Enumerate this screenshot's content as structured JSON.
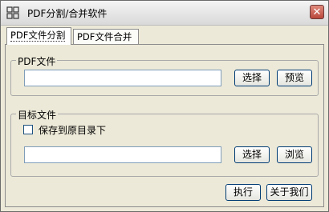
{
  "window": {
    "title": "PDF分割/合并软件",
    "close_glyph": "✕"
  },
  "tabs": [
    {
      "label": "PDF文件分割",
      "active": true
    },
    {
      "label": "PDF文件合并",
      "active": false
    }
  ],
  "pdf_group": {
    "label": "PDF文件",
    "path_value": "",
    "select_label": "选择",
    "preview_label": "预览"
  },
  "target_group": {
    "label": "目标文件",
    "save_to_original_label": "保存到原目录下",
    "save_to_original_checked": false,
    "path_value": "",
    "select_label": "选择",
    "browse_label": "浏览"
  },
  "actions": {
    "execute_label": "执行",
    "about_label": "关于我们"
  },
  "colors": {
    "button_border": "#003c74",
    "field_border": "#7f9db9",
    "panel_bg": "#ece9d8"
  }
}
